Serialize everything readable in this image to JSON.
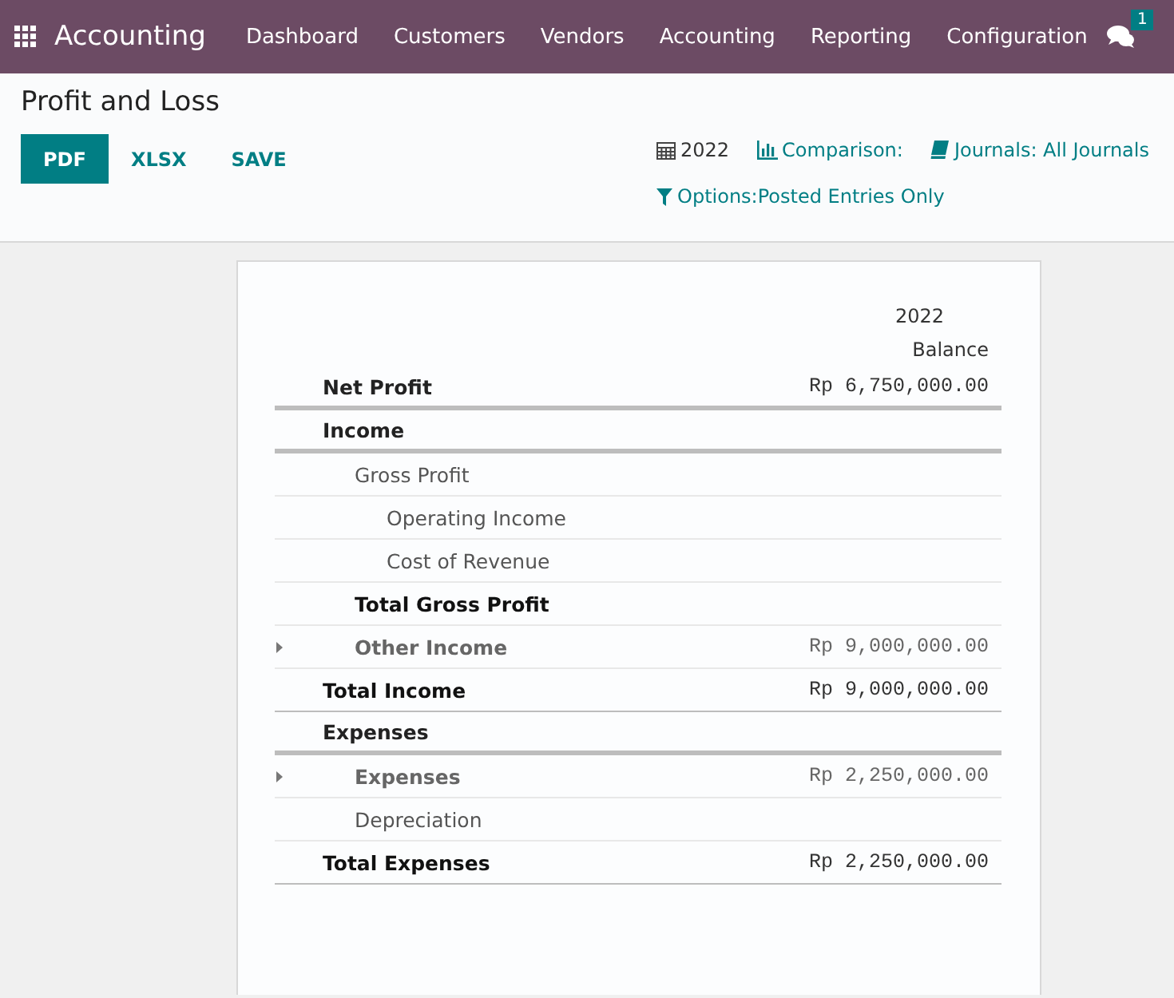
{
  "navbar": {
    "app_name": "Accounting",
    "menu": [
      "Dashboard",
      "Customers",
      "Vendors",
      "Accounting",
      "Reporting",
      "Configuration"
    ],
    "messages_badge": "1"
  },
  "control_panel": {
    "title": "Profit and Loss",
    "buttons": [
      {
        "label": "PDF",
        "primary": true
      },
      {
        "label": "XLSX",
        "primary": false
      },
      {
        "label": "SAVE",
        "primary": false
      }
    ],
    "filters": [
      {
        "kind": "date",
        "label": "2022"
      },
      {
        "kind": "comparison",
        "label": "Comparison:"
      },
      {
        "kind": "journals",
        "label": "Journals: All Journals"
      },
      {
        "kind": "options",
        "label": "Options:Posted Entries Only"
      }
    ]
  },
  "report": {
    "columns": [
      {
        "period": "2022",
        "label": "Balance"
      }
    ],
    "rows": [
      {
        "kind": "section",
        "name": "Net Profit",
        "amount": "Rp 6,750,000.00"
      },
      {
        "kind": "section",
        "name": "Income",
        "children": [
          {
            "kind": "line",
            "name": "Gross Profit",
            "children": [
              {
                "kind": "line",
                "name": "Operating Income"
              },
              {
                "kind": "line",
                "name": "Cost of Revenue"
              }
            ]
          },
          {
            "kind": "total",
            "name": "Total Gross Profit"
          },
          {
            "kind": "account",
            "name": "Other Income",
            "amount": "Rp 9,000,000.00"
          }
        ]
      },
      {
        "kind": "total",
        "name": "Total Income",
        "amount": "Rp 9,000,000.00"
      },
      {
        "kind": "section",
        "name": "Expenses",
        "children": [
          {
            "kind": "account",
            "name": "Expenses",
            "amount": "Rp 2,250,000.00"
          },
          {
            "kind": "line",
            "name": "Depreciation"
          }
        ]
      },
      {
        "kind": "total",
        "name": "Total Expenses",
        "amount": "Rp 2,250,000.00"
      }
    ]
  }
}
